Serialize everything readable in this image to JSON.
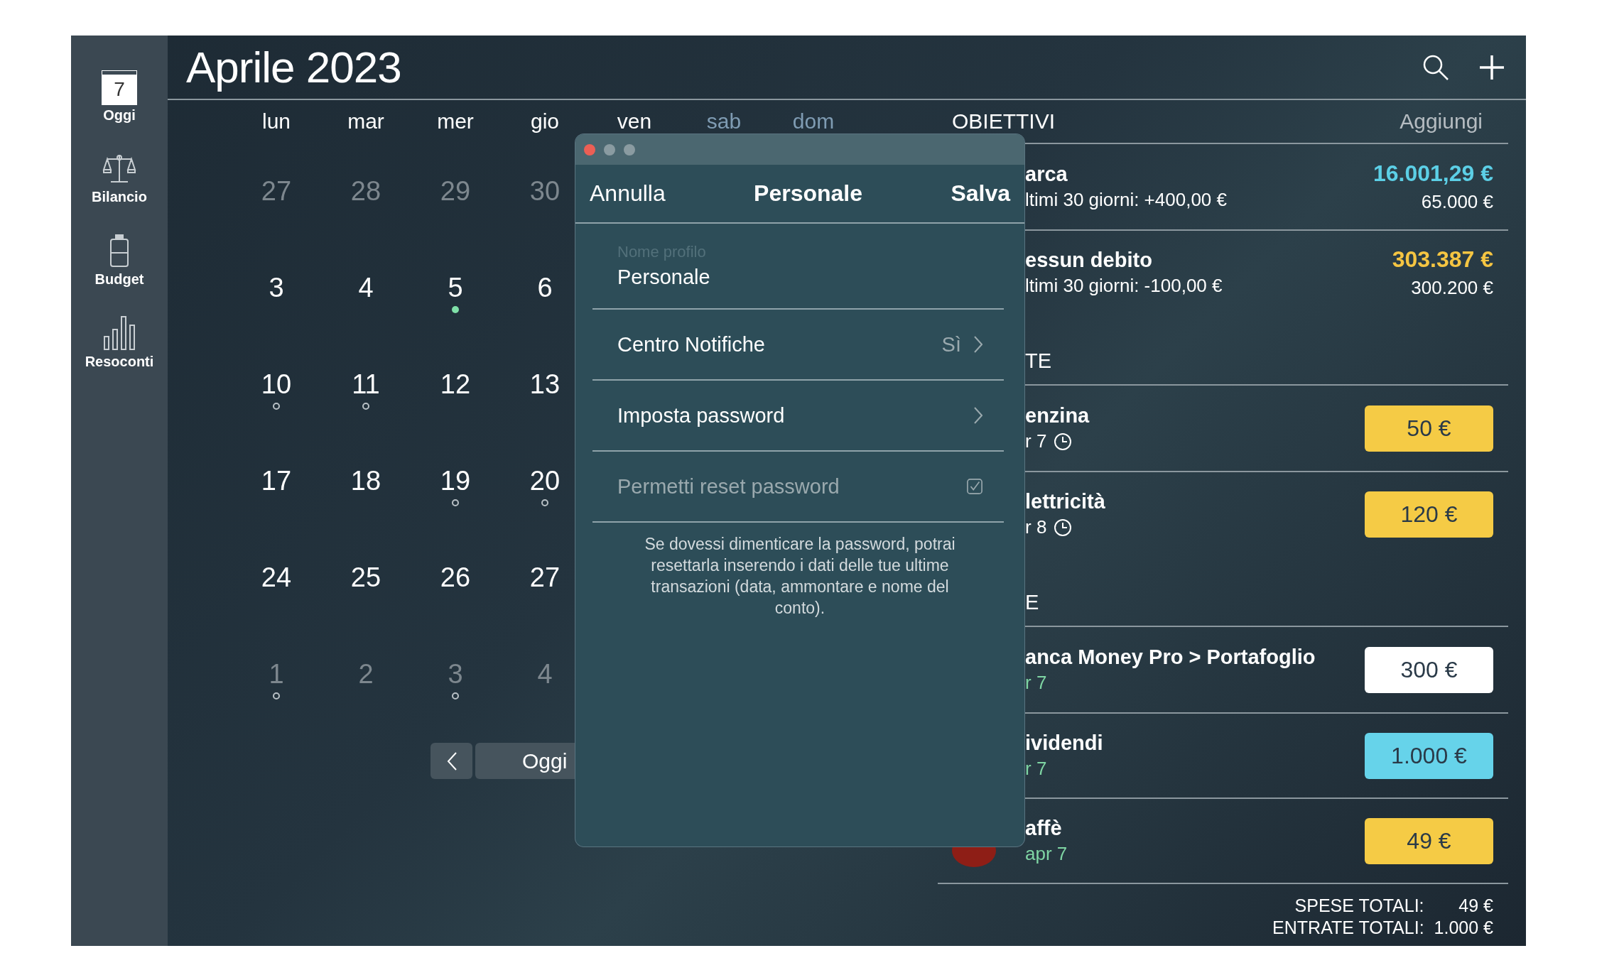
{
  "sidebar": {
    "items": [
      {
        "kind": "calendar",
        "label": "Oggi",
        "icon_text": "7"
      },
      {
        "kind": "scale",
        "label": "Bilancio"
      },
      {
        "kind": "jar",
        "label": "Budget"
      },
      {
        "kind": "bars",
        "label": "Resoconti"
      }
    ]
  },
  "header": {
    "title": "Aprile 2023"
  },
  "calendar": {
    "weekdays": [
      {
        "label": "lun",
        "weekend": false
      },
      {
        "label": "mar",
        "weekend": false
      },
      {
        "label": "mer",
        "weekend": false
      },
      {
        "label": "gio",
        "weekend": false
      },
      {
        "label": "ven",
        "weekend": false
      },
      {
        "label": "sab",
        "weekend": true
      },
      {
        "label": "dom",
        "weekend": true
      }
    ],
    "weeks": [
      [
        {
          "day": "27",
          "other_month": true,
          "kind": "plain"
        },
        {
          "day": "28",
          "other_month": true,
          "kind": "plain"
        },
        {
          "day": "29",
          "other_month": true,
          "kind": "plain"
        },
        {
          "day": "30",
          "other_month": true,
          "kind": "plain"
        }
      ],
      [
        {
          "day": "3",
          "other_month": false,
          "kind": "plain"
        },
        {
          "day": "4",
          "other_month": false,
          "kind": "plain"
        },
        {
          "day": "5",
          "other_month": false,
          "kind": "event_dot"
        },
        {
          "day": "6",
          "other_month": false,
          "kind": "plain"
        }
      ],
      [
        {
          "day": "10",
          "other_month": false,
          "kind": "event_ring"
        },
        {
          "day": "11",
          "other_month": false,
          "kind": "event_ring"
        },
        {
          "day": "12",
          "other_month": false,
          "kind": "plain"
        },
        {
          "day": "13",
          "other_month": false,
          "kind": "plain"
        }
      ],
      [
        {
          "day": "17",
          "other_month": false,
          "kind": "plain"
        },
        {
          "day": "18",
          "other_month": false,
          "kind": "plain"
        },
        {
          "day": "19",
          "other_month": false,
          "kind": "event_ring"
        },
        {
          "day": "20",
          "other_month": false,
          "kind": "event_ring"
        }
      ],
      [
        {
          "day": "24",
          "other_month": false,
          "kind": "plain"
        },
        {
          "day": "25",
          "other_month": false,
          "kind": "plain"
        },
        {
          "day": "26",
          "other_month": false,
          "kind": "plain"
        },
        {
          "day": "27",
          "other_month": false,
          "kind": "plain"
        }
      ],
      [
        {
          "day": "1",
          "other_month": true,
          "kind": "event_ring"
        },
        {
          "day": "2",
          "other_month": true,
          "kind": "plain"
        },
        {
          "day": "3",
          "other_month": true,
          "kind": "event_ring"
        },
        {
          "day": "4",
          "other_month": true,
          "kind": "plain"
        }
      ]
    ],
    "today_button": "Oggi"
  },
  "goals": {
    "title": "OBIETTIVI",
    "action": "Aggiungi",
    "items": [
      {
        "name": "arca",
        "change": "ltimi 30 giorni: +400,00 €",
        "amount": "16.001,29 €",
        "color": "#5ccfe6",
        "target": "65.000 €"
      },
      {
        "name": "essun debito",
        "change": "ltimi 30 giorni: -100,00 €",
        "amount": "303.387 €",
        "color": "#f5c542",
        "target": "300.200 €"
      }
    ]
  },
  "sections": [
    {
      "title": "TE",
      "items": [
        {
          "name": "enzina",
          "date": "r 7",
          "scheduled": true,
          "photo": false,
          "amount": "50 €",
          "color": "#f5cb45"
        },
        {
          "name": "lettricità",
          "date": "r 8",
          "scheduled": true,
          "photo": false,
          "amount": "120 €",
          "color": "#f5cb45"
        }
      ]
    },
    {
      "title": "E",
      "items": [
        {
          "name": "anca Money Pro > Portafoglio",
          "date": "r 7",
          "scheduled": false,
          "photo": false,
          "amount": "300 €",
          "color": "#ffffff"
        },
        {
          "name": "ividendi",
          "date": "r 7",
          "scheduled": false,
          "photo": false,
          "amount": "1.000 €",
          "color": "#66d3ea"
        },
        {
          "name": "affè",
          "date": "apr 7",
          "scheduled": false,
          "photo": true,
          "amount": "49 €",
          "color": "#f5cb45"
        }
      ]
    }
  ],
  "totals": [
    {
      "label": "SPESE TOTALI:",
      "value": "49 €"
    },
    {
      "label": "ENTRATE TOTALI:",
      "value": "1.000 €"
    }
  ],
  "dialog": {
    "cancel": "Annulla",
    "title": "Personale",
    "save": "Salva",
    "field": {
      "label": "Nome profilo",
      "value": "Personale"
    },
    "rows": [
      {
        "kind": "link",
        "label": "Centro Notifiche",
        "value": "Sì",
        "disabled": false
      },
      {
        "kind": "link",
        "label": "Imposta password",
        "disabled": false
      },
      {
        "kind": "checkbox",
        "label": "Permetti reset password",
        "checked": true,
        "disabled": true
      }
    ],
    "note": "Se dovessi dimenticare la password, potrai resettarla inserendo i dati delle tue ultime transazioni (data, ammontare e nome del conto)."
  }
}
